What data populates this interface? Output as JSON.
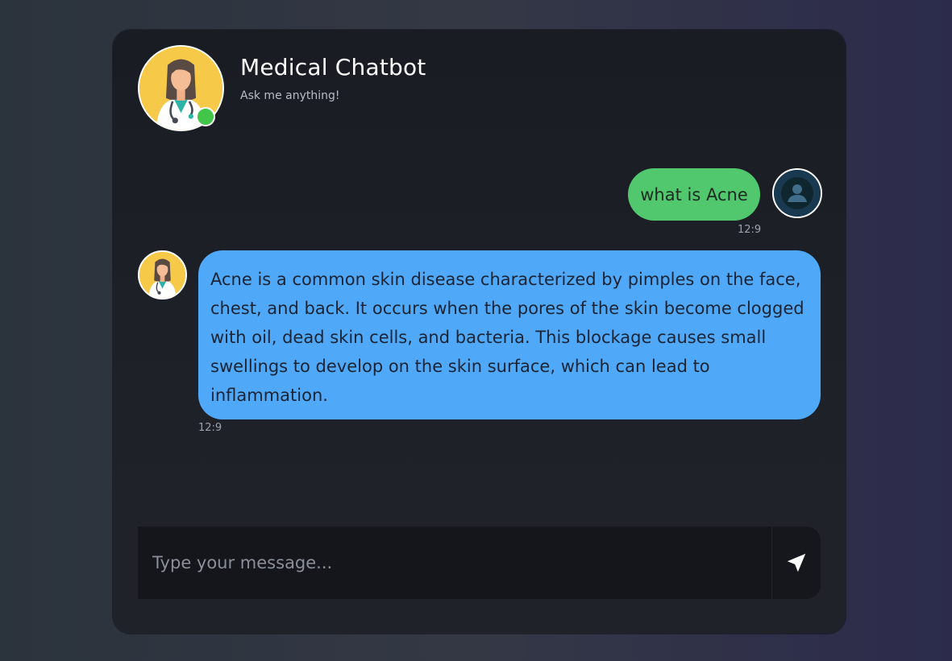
{
  "header": {
    "title": "Medical Chatbot",
    "subtitle": "Ask me anything!",
    "avatar_icon": "doctor-avatar-icon",
    "status": "online",
    "status_color": "#41c64a"
  },
  "messages": [
    {
      "sender": "user",
      "text": "what is Acne",
      "time": "12:9",
      "bubble_color": "#52c86e",
      "avatar_icon": "user-avatar-icon"
    },
    {
      "sender": "bot",
      "text": "Acne is a common skin disease characterized by pimples on the face, chest, and back. It occurs when the pores of the skin become clogged with oil, dead skin cells, and bacteria. This blockage causes small swellings to develop on the skin surface, which can lead to inflammation.",
      "time": "12:9",
      "bubble_color": "#4fa8f8",
      "avatar_icon": "doctor-avatar-icon"
    }
  ],
  "composer": {
    "placeholder": "Type your message...",
    "value": "",
    "send_icon": "send-icon"
  }
}
